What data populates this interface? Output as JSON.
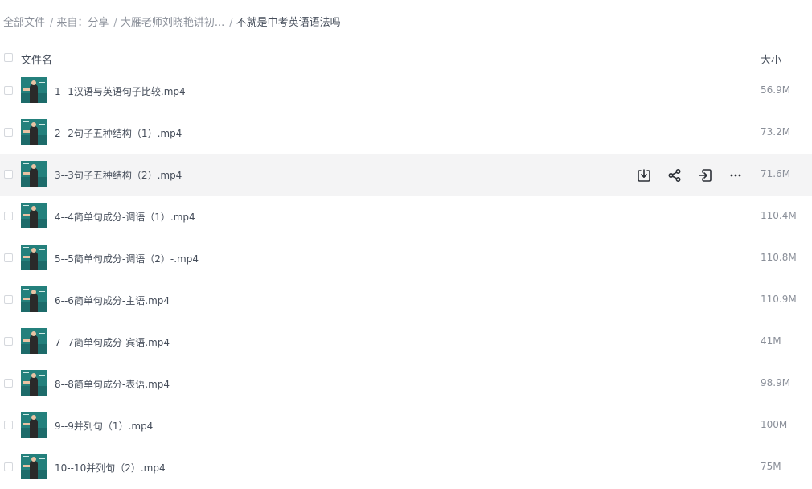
{
  "breadcrumb": {
    "items": [
      "全部文件",
      "来自：分享",
      "大雁老师刘晓艳讲初..."
    ],
    "separator": "/",
    "current": "不就是中考英语语法吗"
  },
  "table": {
    "header_name": "文件名",
    "header_size": "大小"
  },
  "files": [
    {
      "name": "1--1汉语与英语句子比较.mp4",
      "size": "56.9M"
    },
    {
      "name": "2--2句子五种结构（1）.mp4",
      "size": "73.2M"
    },
    {
      "name": "3--3句子五种结构（2）.mp4",
      "size": "71.6M"
    },
    {
      "name": "4--4简单句成分-调语（1）.mp4",
      "size": "110.4M"
    },
    {
      "name": "5--5简单句成分-调语（2）-.mp4",
      "size": "110.8M"
    },
    {
      "name": "6--6简单句成分-主语.mp4",
      "size": "110.9M"
    },
    {
      "name": "7--7简单句成分-宾语.mp4",
      "size": "41M"
    },
    {
      "name": "8--8简单句成分-表语.mp4",
      "size": "98.9M"
    },
    {
      "name": "9--9并列句（1）.mp4",
      "size": "100M"
    },
    {
      "name": "10--10并列句（2）.mp4",
      "size": "75M"
    }
  ],
  "row_actions": [
    "download-icon",
    "share-icon",
    "move-icon",
    "more-icon"
  ],
  "colors": {
    "hover_row": "#f4f4f5",
    "text": "#454d5a",
    "muted": "#8a8f99",
    "board": "#1d6b6a"
  }
}
